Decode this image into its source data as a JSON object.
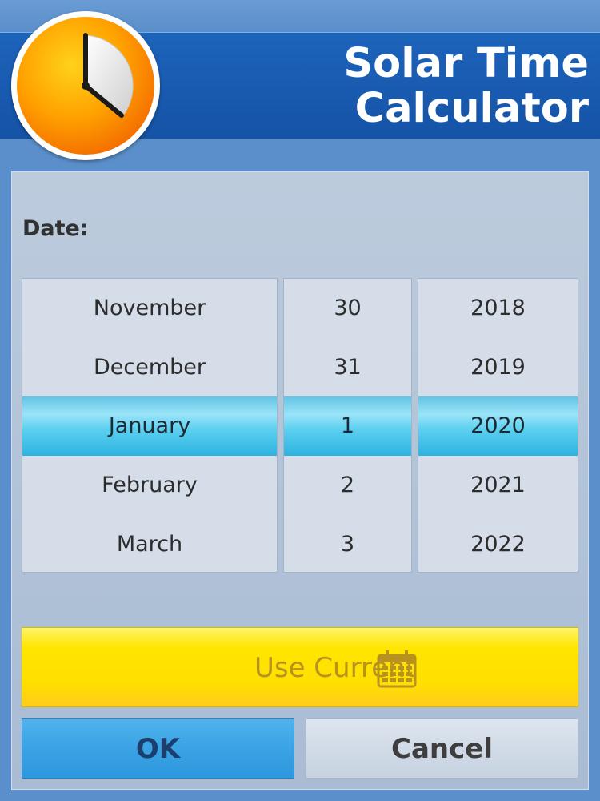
{
  "header": {
    "title_line1": "Solar Time",
    "title_line2": "Calculator",
    "logo_icon": "clock-icon"
  },
  "form": {
    "date_label": "Date:"
  },
  "picker": {
    "months": [
      "November",
      "December",
      "January",
      "February",
      "March"
    ],
    "days": [
      "30",
      "31",
      "1",
      "2",
      "3"
    ],
    "years": [
      "2018",
      "2019",
      "2020",
      "2021",
      "2022"
    ],
    "selected": {
      "month": "January",
      "day": "1",
      "year": "2020"
    }
  },
  "actions": {
    "use_current_label": "Use Current",
    "use_current_icon": "calendar-icon",
    "ok_label": "OK",
    "cancel_label": "Cancel"
  },
  "colors": {
    "title_bar": "#1d64bb",
    "background": "#5b8fcb",
    "selection_highlight": "#5dd0f0",
    "use_current_button": "#ffe600",
    "ok_button": "#3aa3e4",
    "cancel_button": "#d1dbe7",
    "clock_face": "#ffa500"
  }
}
